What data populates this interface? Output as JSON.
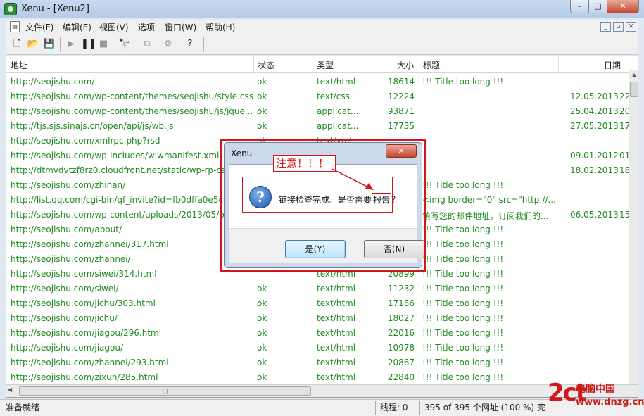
{
  "window": {
    "title": "Xenu - [Xenu2]",
    "min": "–",
    "max": "□",
    "close": "✕"
  },
  "menu": {
    "items": [
      "文件(F)",
      "编辑(E)",
      "视图(V)",
      "选项",
      "窗口(W)",
      "帮助(H)"
    ],
    "mdi": [
      "_",
      "▫",
      "✕"
    ]
  },
  "toolbar": [
    "new-icon",
    "open-icon",
    "save-icon",
    "play-icon",
    "pause-icon",
    "stop-icon",
    "find-icon",
    "copy-icon",
    "properties-icon",
    "help-icon"
  ],
  "columns": {
    "url": "地址",
    "status": "状态",
    "type": "类型",
    "size": "大小",
    "title": "标题",
    "date": "日期"
  },
  "rows": [
    {
      "url": "http://seojishu.com/",
      "status": "ok",
      "type": "text/html",
      "size": "18614",
      "title": "!!! Title too long !!!",
      "date": "",
      "time": ""
    },
    {
      "url": "http://seojishu.com/wp-content/themes/seojishu/style.css",
      "status": "ok",
      "type": "text/css",
      "size": "12224",
      "title": "",
      "date": "12.05.2013",
      "time": "22"
    },
    {
      "url": "http://seojishu.com/wp-content/themes/seojishu/js/jque...",
      "status": "ok",
      "type": "applicat...",
      "size": "93871",
      "title": "",
      "date": "25.04.2013",
      "time": "20"
    },
    {
      "url": "http://tjs.sjs.sinajs.cn/open/api/js/wb.js",
      "status": "ok",
      "type": "applicat...",
      "size": "17735",
      "title": "",
      "date": "27.05.2013",
      "time": "17"
    },
    {
      "url": "http://seojishu.com/xmlrpc.php?rsd",
      "status": "ok",
      "type": "text/xml",
      "size": "",
      "title": "",
      "date": "",
      "time": ""
    },
    {
      "url": "http://seojishu.com/wp-includes/wlwmanifest.xml",
      "status": "",
      "type": "",
      "size": "",
      "title": "",
      "date": "09.01.2012",
      "time": "01"
    },
    {
      "url": "http://dtmvdvtzf8rz0.cloudfront.net/static/wp-rp-css",
      "status": "",
      "type": "",
      "size": "",
      "title": "",
      "date": "18.02.2013",
      "time": "18"
    },
    {
      "url": "http://seojishu.com/zhinan/",
      "status": "",
      "type": "",
      "size": "",
      "title": "!!! Title too long !!!",
      "date": "",
      "time": ""
    },
    {
      "url": "http://list.qq.com/cgi-bin/qf_invite?id=fb0dffa0e5c7",
      "status": "",
      "type": "",
      "size": "",
      "title": "<img border=\"0\" src=\"http://...",
      "date": "",
      "time": ""
    },
    {
      "url": "http://seojishu.com/wp-content/uploads/2013/05/p",
      "status": "",
      "type": "",
      "size": "",
      "title": "填写您的邮件地址，订阅我们的...",
      "date": "06.05.2013",
      "time": "15"
    },
    {
      "url": "http://seojishu.com/about/",
      "status": "",
      "type": "",
      "size": "",
      "title": "!!! Title too long !!!",
      "date": "",
      "time": ""
    },
    {
      "url": "http://seojishu.com/zhannei/317.html",
      "status": "",
      "type": "",
      "size": "",
      "title": "!!! Title too long !!!",
      "date": "",
      "time": ""
    },
    {
      "url": "http://seojishu.com/zhannei/",
      "status": "",
      "type": "",
      "size": "",
      "title": "!!! Title too long !!!",
      "date": "",
      "time": ""
    },
    {
      "url": "http://seojishu.com/siwei/314.html",
      "status": "",
      "type": "text/html",
      "size": "20899",
      "title": "!!! Title too long !!!",
      "date": "",
      "time": ""
    },
    {
      "url": "http://seojishu.com/siwei/",
      "status": "ok",
      "type": "text/html",
      "size": "11232",
      "title": "!!! Title too long !!!",
      "date": "",
      "time": ""
    },
    {
      "url": "http://seojishu.com/jichu/303.html",
      "status": "ok",
      "type": "text/html",
      "size": "17186",
      "title": "!!! Title too long !!!",
      "date": "",
      "time": ""
    },
    {
      "url": "http://seojishu.com/jichu/",
      "status": "ok",
      "type": "text/html",
      "size": "18027",
      "title": "!!! Title too long !!!",
      "date": "",
      "time": ""
    },
    {
      "url": "http://seojishu.com/jiagou/296.html",
      "status": "ok",
      "type": "text/html",
      "size": "22016",
      "title": "!!! Title too long !!!",
      "date": "",
      "time": ""
    },
    {
      "url": "http://seojishu.com/jiagou/",
      "status": "ok",
      "type": "text/html",
      "size": "10978",
      "title": "!!! Title too long !!!",
      "date": "",
      "time": ""
    },
    {
      "url": "http://seojishu.com/zhannei/293.html",
      "status": "ok",
      "type": "text/html",
      "size": "20867",
      "title": "!!! Title too long !!!",
      "date": "",
      "time": ""
    },
    {
      "url": "http://seojishu.com/zixun/285.html",
      "status": "ok",
      "type": "text/html",
      "size": "22840",
      "title": "!!! Title too long !!!",
      "date": "",
      "time": ""
    }
  ],
  "statusbar": {
    "left": "准备就绪",
    "threads": "线程: 0",
    "progress": "395 of 395 个网址 (100 %) 完"
  },
  "dialog": {
    "title": "Xenu",
    "close": "✕",
    "icon": "question-icon",
    "message_pre": "链接检查完成。是否需要",
    "message_highlight": "报告",
    "message_post": "？",
    "yes": "是(Y)",
    "no": "否(N)"
  },
  "annotation": {
    "note": "注意！！！",
    "color": "#d0171b"
  },
  "watermark": {
    "big": "2ct",
    "cn": "电脑中国",
    "url": "www.dnzg.cn"
  },
  "colors": {
    "link_text": "#1f8c1f",
    "accent_red": "#d0171b"
  }
}
